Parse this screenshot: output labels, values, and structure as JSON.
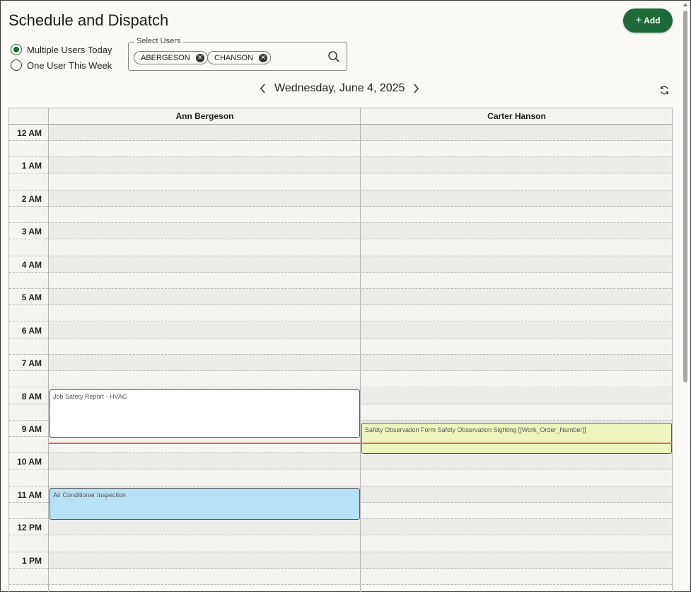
{
  "header": {
    "title": "Schedule and Dispatch",
    "add_label": "Add"
  },
  "view_options": [
    {
      "label": "Multiple Users Today",
      "selected": true
    },
    {
      "label": "One User This Week",
      "selected": false
    }
  ],
  "user_select": {
    "legend": "Select Users",
    "chips": [
      "ABERGESON",
      "CHANSON"
    ]
  },
  "date_nav": {
    "date": "Wednesday, June 4, 2025"
  },
  "calendar": {
    "columns": [
      "Ann Bergeson",
      "Carter Hanson"
    ],
    "hours": [
      "12 AM",
      "1 AM",
      "2 AM",
      "3 AM",
      "4 AM",
      "5 AM",
      "6 AM",
      "7 AM",
      "8 AM",
      "9 AM",
      "10 AM",
      "11 AM",
      "12 PM",
      "1 PM"
    ],
    "events": [
      {
        "title": "Job Safety Report - HVAC",
        "column": 0,
        "color": "#ffffff"
      },
      {
        "title": "Safety Observation Form Safety Observation Sighting [[Work_Order_Number]]",
        "column": 1,
        "color": "#eef4bd"
      },
      {
        "title": "Air Conditioner Inspection",
        "column": 0,
        "color": "#b7e1f7"
      }
    ]
  },
  "colors": {
    "accent": "#1f6b38",
    "now_line": "#d96b5d"
  }
}
